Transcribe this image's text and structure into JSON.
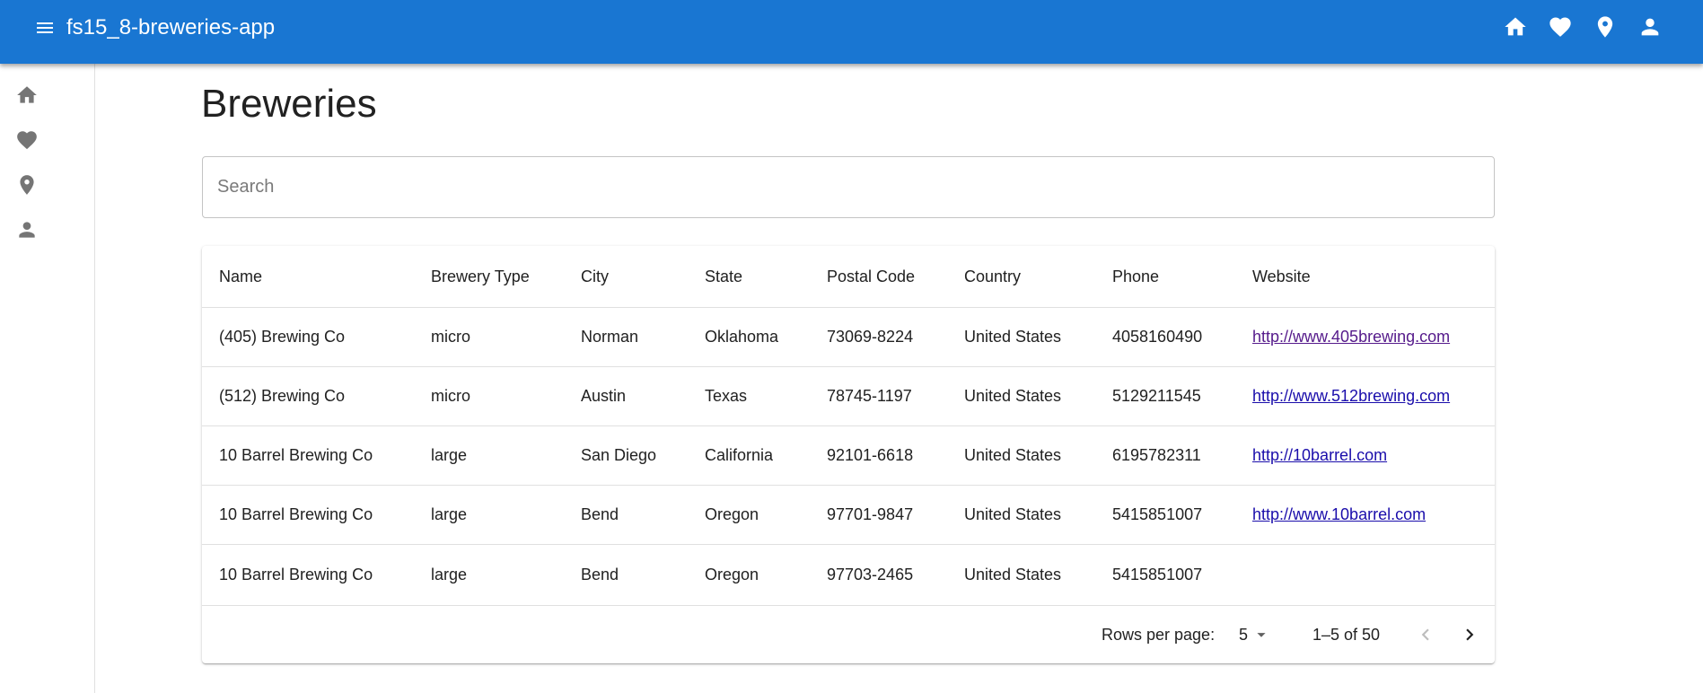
{
  "appbar": {
    "title": "fs15_8-breweries-app",
    "color": "#1976d2",
    "icons": [
      "home-icon",
      "heart-icon",
      "location-pin-icon",
      "person-icon"
    ]
  },
  "drawer": {
    "items": [
      "home-icon",
      "heart-icon",
      "location-pin-icon",
      "person-icon"
    ]
  },
  "main": {
    "title": "Breweries",
    "search": {
      "placeholder": "Search",
      "value": ""
    }
  },
  "table": {
    "columns": [
      "Name",
      "Brewery Type",
      "City",
      "State",
      "Postal Code",
      "Country",
      "Phone",
      "Website"
    ],
    "rows": [
      [
        "(405) Brewing Co",
        "micro",
        "Norman",
        "Oklahoma",
        "73069-8224",
        "United States",
        "4058160490",
        "http://www.405brewing.com"
      ],
      [
        "(512) Brewing Co",
        "micro",
        "Austin",
        "Texas",
        "78745-1197",
        "United States",
        "5129211545",
        "http://www.512brewing.com"
      ],
      [
        "10 Barrel Brewing Co",
        "large",
        "San Diego",
        "California",
        "92101-6618",
        "United States",
        "6195782311",
        "http://10barrel.com"
      ],
      [
        "10 Barrel Brewing Co",
        "large",
        "Bend",
        "Oregon",
        "97701-9847",
        "United States",
        "5415851007",
        "http://www.10barrel.com"
      ],
      [
        "10 Barrel Brewing Co",
        "large",
        "Bend",
        "Oregon",
        "97703-2465",
        "United States",
        "5415851007",
        ""
      ]
    ],
    "link_color": "#1a0dab",
    "visited_link_color": "#551a8b"
  },
  "pagination": {
    "rows_per_page_label": "Rows per page:",
    "rows_per_page_value": "5",
    "range_text": "1–5 of 50"
  }
}
